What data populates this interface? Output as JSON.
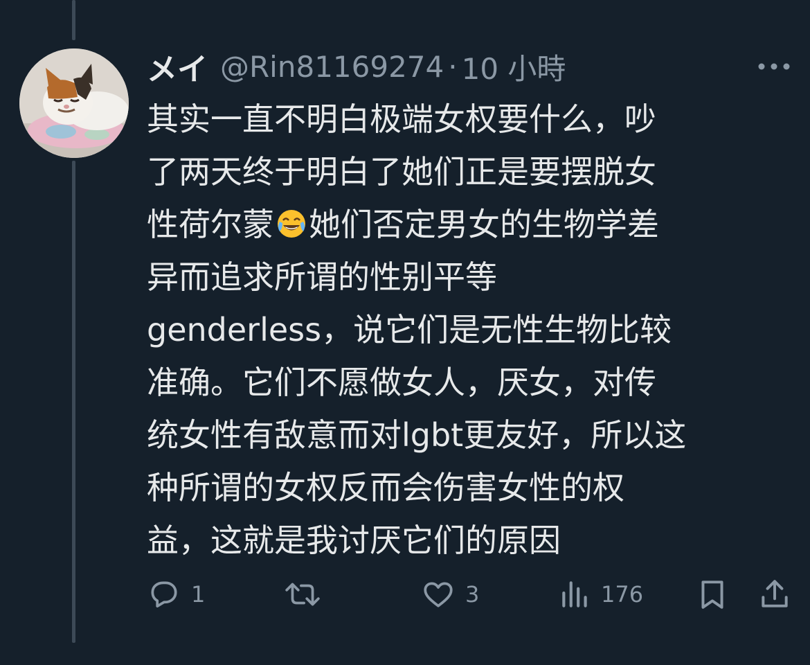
{
  "tweet": {
    "author": {
      "display_name": "メイ",
      "handle": "@Rin81169274",
      "avatar_icon": "cat-avatar"
    },
    "separator": "·",
    "time": "10 小時",
    "more_icon": "more-icon",
    "text_lines": [
      "其实一直不明白极端女权要什么，吵",
      "了两天终于明白了她们正是要摆脱女",
      "性荷尔蒙",
      "她们否定男女的生物学差",
      "异而追求所谓的性别平等",
      "genderless，说它们是无性生物比较",
      "准确。它们不愿做女人，厌女，对传",
      "统女性有敌意而对lgbt更友好，所以这",
      "种所谓的女权反而会伤害女性的权",
      "益，这就是我讨厌它们的原因"
    ],
    "inline_emoji": "face-with-tears-of-joy",
    "actions": {
      "reply": {
        "icon": "reply-icon",
        "count": "1"
      },
      "retweet": {
        "icon": "retweet-icon",
        "count": ""
      },
      "like": {
        "icon": "heart-icon",
        "count": "3"
      },
      "views": {
        "icon": "views-icon",
        "count": "176"
      },
      "bookmark": {
        "icon": "bookmark-icon"
      },
      "share": {
        "icon": "share-icon"
      }
    }
  },
  "colors": {
    "background": "#15202b",
    "text_primary": "#e7e9ea",
    "text_secondary": "#8b98a5",
    "thread_line": "#3d4a57"
  }
}
